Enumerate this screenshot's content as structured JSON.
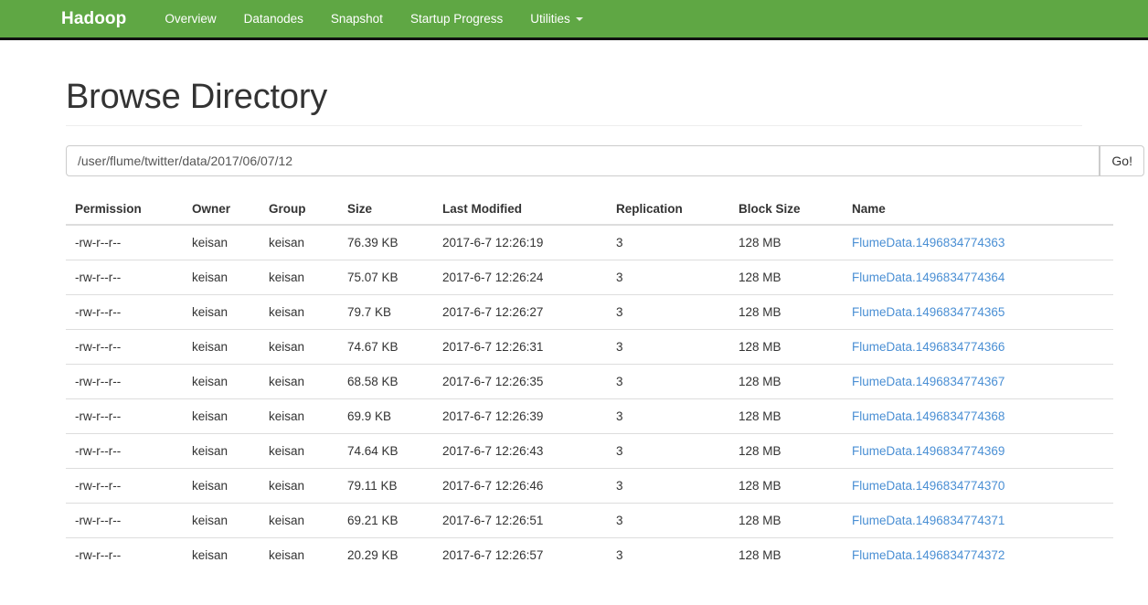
{
  "navbar": {
    "brand": "Hadoop",
    "items": [
      {
        "label": "Overview",
        "has_caret": false
      },
      {
        "label": "Datanodes",
        "has_caret": false
      },
      {
        "label": "Snapshot",
        "has_caret": false
      },
      {
        "label": "Startup Progress",
        "has_caret": false
      },
      {
        "label": "Utilities",
        "has_caret": true
      }
    ],
    "background_color": "#5fa744"
  },
  "page": {
    "title": "Browse Directory"
  },
  "path_bar": {
    "value": "/user/flume/twitter/data/2017/06/07/12",
    "placeholder": "/user/flume/twitter/data/2017/06/07/12",
    "go_label": "Go!"
  },
  "table": {
    "columns": [
      "Permission",
      "Owner",
      "Group",
      "Size",
      "Last Modified",
      "Replication",
      "Block Size",
      "Name"
    ],
    "rows": [
      {
        "permission": "-rw-r--r--",
        "owner": "keisan",
        "group": "keisan",
        "size": "76.39 KB",
        "last_modified": "2017-6-7 12:26:19",
        "replication": "3",
        "block_size": "128 MB",
        "name": "FlumeData.1496834774363"
      },
      {
        "permission": "-rw-r--r--",
        "owner": "keisan",
        "group": "keisan",
        "size": "75.07 KB",
        "last_modified": "2017-6-7 12:26:24",
        "replication": "3",
        "block_size": "128 MB",
        "name": "FlumeData.1496834774364"
      },
      {
        "permission": "-rw-r--r--",
        "owner": "keisan",
        "group": "keisan",
        "size": "79.7 KB",
        "last_modified": "2017-6-7 12:26:27",
        "replication": "3",
        "block_size": "128 MB",
        "name": "FlumeData.1496834774365"
      },
      {
        "permission": "-rw-r--r--",
        "owner": "keisan",
        "group": "keisan",
        "size": "74.67 KB",
        "last_modified": "2017-6-7 12:26:31",
        "replication": "3",
        "block_size": "128 MB",
        "name": "FlumeData.1496834774366"
      },
      {
        "permission": "-rw-r--r--",
        "owner": "keisan",
        "group": "keisan",
        "size": "68.58 KB",
        "last_modified": "2017-6-7 12:26:35",
        "replication": "3",
        "block_size": "128 MB",
        "name": "FlumeData.1496834774367"
      },
      {
        "permission": "-rw-r--r--",
        "owner": "keisan",
        "group": "keisan",
        "size": "69.9 KB",
        "last_modified": "2017-6-7 12:26:39",
        "replication": "3",
        "block_size": "128 MB",
        "name": "FlumeData.1496834774368"
      },
      {
        "permission": "-rw-r--r--",
        "owner": "keisan",
        "group": "keisan",
        "size": "74.64 KB",
        "last_modified": "2017-6-7 12:26:43",
        "replication": "3",
        "block_size": "128 MB",
        "name": "FlumeData.1496834774369"
      },
      {
        "permission": "-rw-r--r--",
        "owner": "keisan",
        "group": "keisan",
        "size": "79.11 KB",
        "last_modified": "2017-6-7 12:26:46",
        "replication": "3",
        "block_size": "128 MB",
        "name": "FlumeData.1496834774370"
      },
      {
        "permission": "-rw-r--r--",
        "owner": "keisan",
        "group": "keisan",
        "size": "69.21 KB",
        "last_modified": "2017-6-7 12:26:51",
        "replication": "3",
        "block_size": "128 MB",
        "name": "FlumeData.1496834774371"
      },
      {
        "permission": "-rw-r--r--",
        "owner": "keisan",
        "group": "keisan",
        "size": "20.29 KB",
        "last_modified": "2017-6-7 12:26:57",
        "replication": "3",
        "block_size": "128 MB",
        "name": "FlumeData.1496834774372"
      }
    ]
  },
  "colors": {
    "navbar_green": "#5fa744",
    "link_blue": "#4a8fd4",
    "text": "#333333",
    "border": "#dddddd"
  }
}
